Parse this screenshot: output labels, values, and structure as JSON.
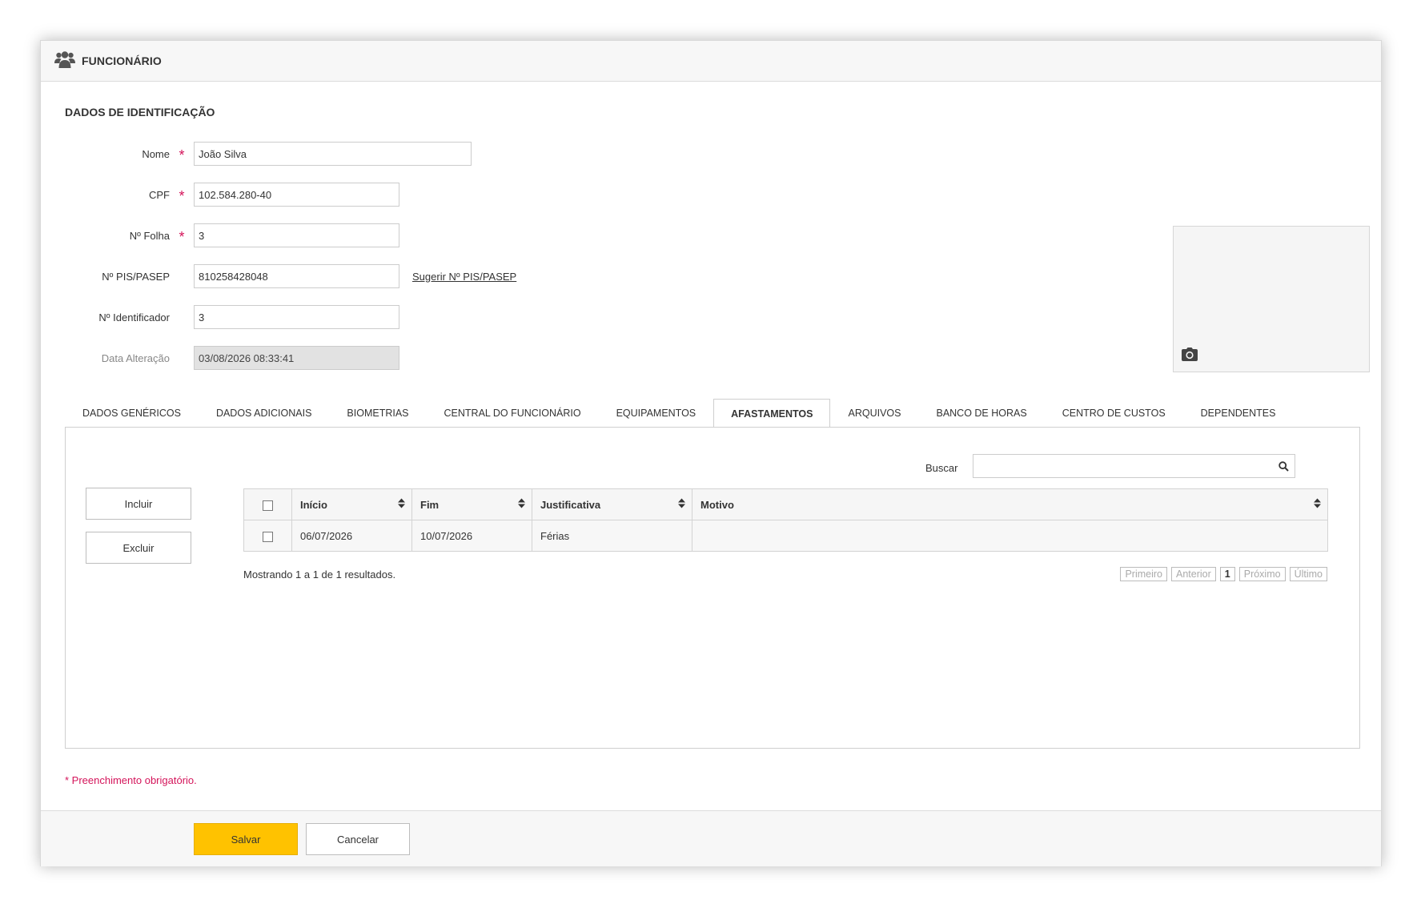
{
  "header": {
    "title": "FUNCIONÁRIO",
    "icon": "users-icon"
  },
  "section": {
    "title": "DADOS DE IDENTIFICAÇÃO"
  },
  "form": {
    "nome": {
      "label": "Nome",
      "value": "João Silva",
      "required": true
    },
    "cpf": {
      "label": "CPF",
      "value": "102.584.280-40",
      "required": true
    },
    "folha": {
      "label": "Nº Folha",
      "value": "3",
      "required": true
    },
    "pis": {
      "label": "Nº PIS/PASEP",
      "value": "810258428048",
      "link": "Sugerir Nº PIS/PASEP"
    },
    "identificador": {
      "label": "Nº Identificador",
      "value": "3"
    },
    "data_alteracao": {
      "label": "Data Alteração",
      "value": "03/08/2026 08:33:41"
    },
    "required_mark": "*"
  },
  "photo": {
    "icon": "camera-icon"
  },
  "tabs": [
    {
      "label": "DADOS GENÉRICOS"
    },
    {
      "label": "DADOS ADICIONAIS"
    },
    {
      "label": "BIOMETRIAS"
    },
    {
      "label": "CENTRAL DO FUNCIONÁRIO"
    },
    {
      "label": "EQUIPAMENTOS"
    },
    {
      "label": "AFASTAMENTOS"
    },
    {
      "label": "ARQUIVOS"
    },
    {
      "label": "BANCO DE HORAS"
    },
    {
      "label": "CENTRO DE CUSTOS"
    },
    {
      "label": "DEPENDENTES"
    }
  ],
  "active_tab": "AFASTAMENTOS",
  "panel": {
    "include_label": "Incluir",
    "exclude_label": "Excluir",
    "search_label": "Buscar",
    "search_value": "",
    "table": {
      "columns": [
        "Início",
        "Fim",
        "Justificativa",
        "Motivo"
      ],
      "rows": [
        {
          "inicio": "06/07/2026",
          "fim": "10/07/2026",
          "justificativa": "Férias",
          "motivo": ""
        }
      ]
    },
    "results_text": "Mostrando 1 a 1 de 1 resultados.",
    "pager": {
      "first": "Primeiro",
      "prev": "Anterior",
      "current": "1",
      "next": "Próximo",
      "last": "Último"
    }
  },
  "required_note": "* Preenchimento obrigatório.",
  "footer": {
    "save_label": "Salvar",
    "cancel_label": "Cancelar"
  },
  "colors": {
    "accent": "#ffc200",
    "required": "#d4145a",
    "disabled_bg": "#e2e2e2"
  }
}
